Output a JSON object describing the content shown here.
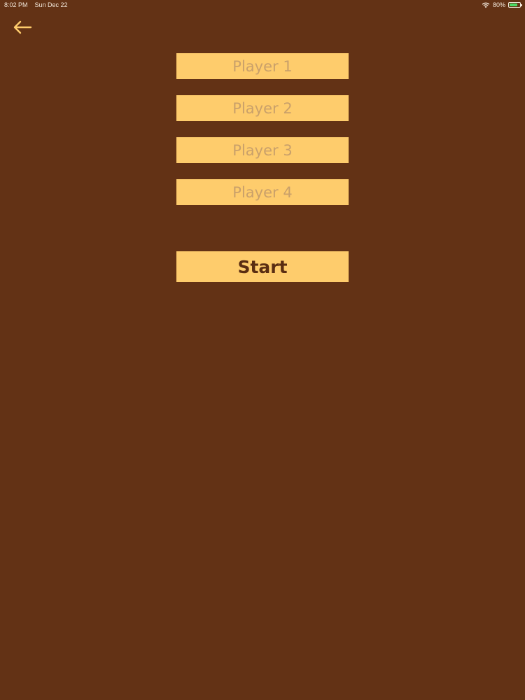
{
  "status_bar": {
    "time": "8:02 PM",
    "date": "Sun Dec 22",
    "battery_percent": "80%",
    "battery_level": 0.8,
    "wifi_icon": "wifi-icon",
    "battery_icon": "battery-icon"
  },
  "navigation": {
    "back_icon": "arrow-left-icon"
  },
  "players": [
    {
      "placeholder": "Player 1",
      "value": ""
    },
    {
      "placeholder": "Player 2",
      "value": ""
    },
    {
      "placeholder": "Player 3",
      "value": ""
    },
    {
      "placeholder": "Player 4",
      "value": ""
    }
  ],
  "start_button": {
    "label": "Start"
  },
  "colors": {
    "background": "#633215",
    "field": "#fecc6c",
    "placeholder_text": "#c9a06a",
    "button_text": "#5a2d12",
    "accent": "#fecc6c"
  }
}
